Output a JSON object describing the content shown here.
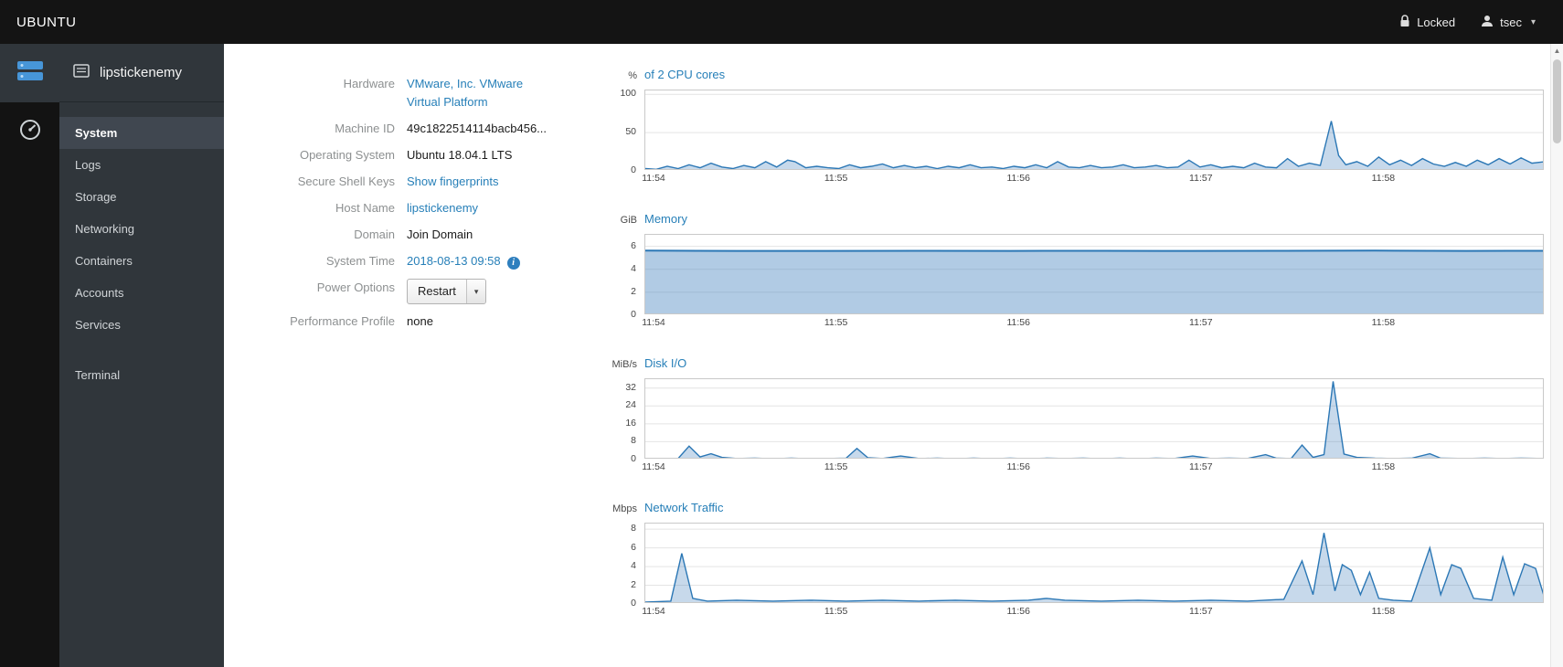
{
  "topbar": {
    "brand": "UBUNTU",
    "locked_label": "Locked",
    "user_label": "tsec"
  },
  "sidebar": {
    "host": "lipstickenemy",
    "items": [
      {
        "label": "System",
        "active": true
      },
      {
        "label": "Logs"
      },
      {
        "label": "Storage"
      },
      {
        "label": "Networking"
      },
      {
        "label": "Containers"
      },
      {
        "label": "Accounts"
      },
      {
        "label": "Services"
      },
      {
        "label": "Terminal",
        "separated": true
      }
    ]
  },
  "system_info": {
    "rows": [
      {
        "label": "Hardware",
        "value": "VMware, Inc. VMware Virtual Platform",
        "type": "link"
      },
      {
        "label": "Machine ID",
        "value": "49c1822514114bacb456...",
        "type": "text"
      },
      {
        "label": "Operating System",
        "value": "Ubuntu 18.04.1 LTS",
        "type": "text"
      },
      {
        "label": "Secure Shell Keys",
        "value": "Show fingerprints",
        "type": "link"
      },
      {
        "label": "Host Name",
        "value": "lipstickenemy",
        "type": "link"
      },
      {
        "label": "Domain",
        "value": "Join Domain",
        "type": "text"
      },
      {
        "label": "System Time",
        "value": "2018-08-13 09:58",
        "type": "link-info"
      },
      {
        "label": "Power Options",
        "value": "Restart",
        "type": "button"
      },
      {
        "label": "Performance Profile",
        "value": "none",
        "type": "text"
      }
    ]
  },
  "colors": {
    "accent": "#267fb8",
    "chart_line": "#2b77b5",
    "chart_fill": "rgba(70,130,190,0.30)"
  },
  "chart_data": [
    {
      "type": "area",
      "key": "cpu",
      "unit": "%",
      "title": "of 2 CPU cores",
      "ylim": [
        0,
        105
      ],
      "yticks": [
        0,
        50,
        100
      ],
      "xlim": [
        0,
        4.93
      ],
      "xticks": [
        {
          "v": 0.05,
          "label": "11:54"
        },
        {
          "v": 1.05,
          "label": "11:55"
        },
        {
          "v": 2.05,
          "label": "11:56"
        },
        {
          "v": 3.05,
          "label": "11:57"
        },
        {
          "v": 4.05,
          "label": "11:58"
        }
      ],
      "points": [
        [
          0,
          3
        ],
        [
          0.06,
          2
        ],
        [
          0.12,
          6
        ],
        [
          0.18,
          3
        ],
        [
          0.24,
          8
        ],
        [
          0.3,
          4
        ],
        [
          0.36,
          10
        ],
        [
          0.42,
          5
        ],
        [
          0.48,
          3
        ],
        [
          0.54,
          7
        ],
        [
          0.6,
          4
        ],
        [
          0.66,
          12
        ],
        [
          0.72,
          5
        ],
        [
          0.78,
          14
        ],
        [
          0.82,
          12
        ],
        [
          0.88,
          4
        ],
        [
          0.94,
          6
        ],
        [
          1,
          4
        ],
        [
          1.06,
          3
        ],
        [
          1.12,
          8
        ],
        [
          1.18,
          4
        ],
        [
          1.24,
          6
        ],
        [
          1.3,
          9
        ],
        [
          1.36,
          4
        ],
        [
          1.42,
          7
        ],
        [
          1.48,
          4
        ],
        [
          1.54,
          6
        ],
        [
          1.6,
          3
        ],
        [
          1.66,
          6
        ],
        [
          1.72,
          4
        ],
        [
          1.78,
          8
        ],
        [
          1.84,
          4
        ],
        [
          1.9,
          5
        ],
        [
          1.96,
          3
        ],
        [
          2.02,
          6
        ],
        [
          2.08,
          4
        ],
        [
          2.14,
          8
        ],
        [
          2.2,
          4
        ],
        [
          2.26,
          12
        ],
        [
          2.32,
          5
        ],
        [
          2.38,
          4
        ],
        [
          2.44,
          7
        ],
        [
          2.5,
          4
        ],
        [
          2.56,
          5
        ],
        [
          2.62,
          8
        ],
        [
          2.68,
          4
        ],
        [
          2.74,
          5
        ],
        [
          2.8,
          7
        ],
        [
          2.86,
          4
        ],
        [
          2.92,
          5
        ],
        [
          2.98,
          14
        ],
        [
          3.04,
          5
        ],
        [
          3.1,
          8
        ],
        [
          3.16,
          4
        ],
        [
          3.22,
          6
        ],
        [
          3.28,
          4
        ],
        [
          3.34,
          10
        ],
        [
          3.4,
          5
        ],
        [
          3.46,
          4
        ],
        [
          3.52,
          16
        ],
        [
          3.58,
          6
        ],
        [
          3.64,
          10
        ],
        [
          3.7,
          7
        ],
        [
          3.76,
          65
        ],
        [
          3.8,
          20
        ],
        [
          3.84,
          8
        ],
        [
          3.9,
          12
        ],
        [
          3.96,
          6
        ],
        [
          4.02,
          18
        ],
        [
          4.08,
          8
        ],
        [
          4.14,
          14
        ],
        [
          4.2,
          7
        ],
        [
          4.26,
          16
        ],
        [
          4.32,
          9
        ],
        [
          4.38,
          6
        ],
        [
          4.44,
          11
        ],
        [
          4.5,
          6
        ],
        [
          4.56,
          14
        ],
        [
          4.62,
          8
        ],
        [
          4.68,
          16
        ],
        [
          4.74,
          9
        ],
        [
          4.8,
          17
        ],
        [
          4.86,
          10
        ],
        [
          4.93,
          12
        ]
      ]
    },
    {
      "type": "area",
      "key": "memory",
      "unit": "GiB",
      "title": "Memory",
      "ylim": [
        0,
        7
      ],
      "yticks": [
        0,
        2,
        4,
        6
      ],
      "xlim": [
        0,
        4.93
      ],
      "xticks": [
        {
          "v": 0.05,
          "label": "11:54"
        },
        {
          "v": 1.05,
          "label": "11:55"
        },
        {
          "v": 2.05,
          "label": "11:56"
        },
        {
          "v": 3.05,
          "label": "11:57"
        },
        {
          "v": 4.05,
          "label": "11:58"
        }
      ],
      "fill": "rgba(70,130,190,0.42)",
      "line_width": 2,
      "points": [
        [
          0,
          5.62
        ],
        [
          0.5,
          5.6
        ],
        [
          1,
          5.6
        ],
        [
          1.5,
          5.61
        ],
        [
          2,
          5.6
        ],
        [
          2.5,
          5.61
        ],
        [
          3,
          5.6
        ],
        [
          3.5,
          5.61
        ],
        [
          4,
          5.62
        ],
        [
          4.5,
          5.6
        ],
        [
          4.93,
          5.61
        ]
      ]
    },
    {
      "type": "area",
      "key": "disk-io",
      "unit": "MiB/s",
      "title": "Disk I/O",
      "ylim": [
        0,
        36
      ],
      "yticks": [
        0,
        8,
        16,
        24,
        32
      ],
      "xlim": [
        0,
        4.93
      ],
      "xticks": [
        {
          "v": 0.05,
          "label": "11:54"
        },
        {
          "v": 1.05,
          "label": "11:55"
        },
        {
          "v": 2.05,
          "label": "11:56"
        },
        {
          "v": 3.05,
          "label": "11:57"
        },
        {
          "v": 4.05,
          "label": "11:58"
        }
      ],
      "points": [
        [
          0,
          0.4
        ],
        [
          0.18,
          0.5
        ],
        [
          0.24,
          6
        ],
        [
          0.3,
          1.2
        ],
        [
          0.36,
          2.6
        ],
        [
          0.42,
          1
        ],
        [
          0.5,
          0.5
        ],
        [
          0.6,
          0.6
        ],
        [
          0.7,
          0.4
        ],
        [
          0.8,
          0.6
        ],
        [
          0.9,
          0.4
        ],
        [
          1,
          0.5
        ],
        [
          1.1,
          0.6
        ],
        [
          1.16,
          5
        ],
        [
          1.22,
          0.8
        ],
        [
          1.3,
          0.5
        ],
        [
          1.4,
          1.6
        ],
        [
          1.5,
          0.5
        ],
        [
          1.6,
          0.6
        ],
        [
          1.7,
          0.4
        ],
        [
          1.8,
          0.6
        ],
        [
          1.9,
          0.4
        ],
        [
          2,
          0.6
        ],
        [
          2.1,
          0.4
        ],
        [
          2.2,
          0.6
        ],
        [
          2.3,
          0.5
        ],
        [
          2.4,
          0.6
        ],
        [
          2.5,
          0.4
        ],
        [
          2.6,
          0.6
        ],
        [
          2.7,
          0.4
        ],
        [
          2.8,
          0.6
        ],
        [
          2.9,
          0.5
        ],
        [
          3,
          1.6
        ],
        [
          3.1,
          0.5
        ],
        [
          3.2,
          0.6
        ],
        [
          3.3,
          0.5
        ],
        [
          3.4,
          2.2
        ],
        [
          3.46,
          0.6
        ],
        [
          3.54,
          0.5
        ],
        [
          3.6,
          6.5
        ],
        [
          3.66,
          1
        ],
        [
          3.72,
          2.2
        ],
        [
          3.77,
          35
        ],
        [
          3.83,
          2.5
        ],
        [
          3.9,
          1
        ],
        [
          4,
          0.6
        ],
        [
          4.1,
          0.5
        ],
        [
          4.2,
          0.6
        ],
        [
          4.3,
          2.6
        ],
        [
          4.36,
          0.6
        ],
        [
          4.5,
          0.5
        ],
        [
          4.6,
          0.6
        ],
        [
          4.7,
          0.5
        ],
        [
          4.8,
          0.6
        ],
        [
          4.93,
          0.5
        ]
      ]
    },
    {
      "type": "area",
      "key": "network",
      "unit": "Mbps",
      "title": "Network Traffic",
      "ylim": [
        0,
        8.6
      ],
      "yticks": [
        0,
        2,
        4,
        6,
        8
      ],
      "xlim": [
        0,
        4.93
      ],
      "xticks": [
        {
          "v": 0.05,
          "label": "11:54"
        },
        {
          "v": 1.05,
          "label": "11:55"
        },
        {
          "v": 2.05,
          "label": "11:56"
        },
        {
          "v": 3.05,
          "label": "11:57"
        },
        {
          "v": 4.05,
          "label": "11:58"
        }
      ],
      "points": [
        [
          0,
          0.2
        ],
        [
          0.14,
          0.3
        ],
        [
          0.2,
          5.4
        ],
        [
          0.26,
          0.6
        ],
        [
          0.34,
          0.3
        ],
        [
          0.5,
          0.4
        ],
        [
          0.7,
          0.3
        ],
        [
          0.9,
          0.4
        ],
        [
          1.1,
          0.3
        ],
        [
          1.3,
          0.4
        ],
        [
          1.5,
          0.3
        ],
        [
          1.7,
          0.4
        ],
        [
          1.9,
          0.3
        ],
        [
          2.1,
          0.4
        ],
        [
          2.2,
          0.6
        ],
        [
          2.3,
          0.4
        ],
        [
          2.5,
          0.3
        ],
        [
          2.7,
          0.4
        ],
        [
          2.9,
          0.3
        ],
        [
          3.1,
          0.4
        ],
        [
          3.3,
          0.3
        ],
        [
          3.5,
          0.5
        ],
        [
          3.6,
          4.6
        ],
        [
          3.66,
          1
        ],
        [
          3.72,
          7.6
        ],
        [
          3.78,
          1.4
        ],
        [
          3.82,
          4.2
        ],
        [
          3.87,
          3.6
        ],
        [
          3.92,
          1
        ],
        [
          3.97,
          3.4
        ],
        [
          4.02,
          0.6
        ],
        [
          4.1,
          0.4
        ],
        [
          4.2,
          0.3
        ],
        [
          4.3,
          6
        ],
        [
          4.36,
          1
        ],
        [
          4.42,
          4.2
        ],
        [
          4.47,
          3.8
        ],
        [
          4.54,
          0.6
        ],
        [
          4.64,
          0.4
        ],
        [
          4.7,
          5
        ],
        [
          4.76,
          1
        ],
        [
          4.82,
          4.3
        ],
        [
          4.88,
          3.8
        ],
        [
          4.93,
          0.6
        ]
      ]
    }
  ]
}
